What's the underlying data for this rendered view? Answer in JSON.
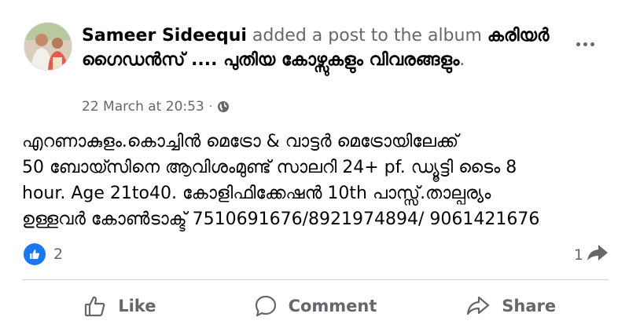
{
  "post": {
    "author": "Sameer Sideequi",
    "action_text": " added a post to the album ",
    "album_title": "കരിയർ ഗൈഡൻസ് .... പുതിയ കോഴ്സുകളും വിവരങ്ങളും",
    "album_suffix": ".",
    "timestamp": "22 March at 20:53",
    "separator": "·",
    "privacy_icon": "globe-icon",
    "body": "എറണാകുളം.കൊച്ചിൻ മെട്രോ & വാട്ടർ മെട്രോയിലേക്ക്\n50 ബോയ്സിനെ ആവിശംമുണ്ട് സാലറി 24+ pf. ഡ്യൂട്ടി ടൈം 8\nhour. Age 21to40. കോളിഫിക്കേഷൻ 10th പാസ്സ്.താല്പര്യം\nഉള്ളവർ കോൺടാക്ട് 7510691676/8921974894/ 9061421676"
  },
  "reactions": {
    "like_count": "2",
    "share_count": "1"
  },
  "actions": {
    "like_label": "Like",
    "comment_label": "Comment",
    "share_label": "Share"
  },
  "colors": {
    "accent": "#1877f2",
    "secondary_text": "#65676b",
    "divider": "#ced0d4"
  }
}
